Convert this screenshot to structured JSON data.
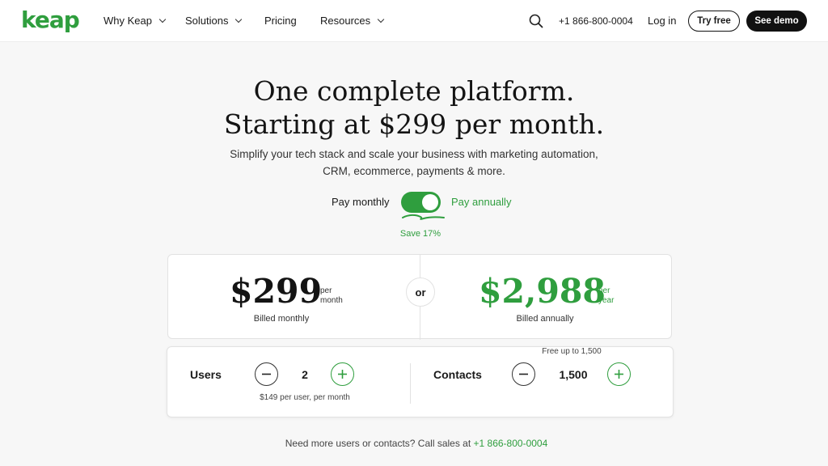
{
  "brand": {
    "logo_text": "keap",
    "accent_color": "#2f9e3e"
  },
  "nav": {
    "items": [
      {
        "label": "Why Keap",
        "has_dropdown": true
      },
      {
        "label": "Solutions",
        "has_dropdown": true
      },
      {
        "label": "Pricing",
        "has_dropdown": false
      },
      {
        "label": "Resources",
        "has_dropdown": true
      }
    ],
    "search_icon": "search-icon",
    "phone": "+1 866-800-0004",
    "login_label": "Log in",
    "try_free_label": "Try free",
    "see_demo_label": "See demo"
  },
  "hero": {
    "title_line1": "One complete platform.",
    "title_line2": "Starting at $299 per month.",
    "subtitle_line1": "Simplify your tech stack and scale your business with marketing automation,",
    "subtitle_line2": "CRM, ecommerce, payments & more."
  },
  "billing_toggle": {
    "monthly_label": "Pay monthly",
    "annual_label": "Pay annually",
    "selected": "annually",
    "save_label": "Save 17%"
  },
  "pricing": {
    "monthly": {
      "amount": "$299",
      "per_line1": "per",
      "per_line2": "month",
      "billed": "Billed monthly"
    },
    "or_label": "or",
    "annual": {
      "amount": "$2,988",
      "per_line1": "per",
      "per_line2": "year",
      "billed": "Billed annually"
    }
  },
  "quantities": {
    "users": {
      "label": "Users",
      "value": "2",
      "note": "$149 per user, per month"
    },
    "contacts": {
      "label": "Contacts",
      "value": "1,500",
      "note": "Free up to 1,500"
    }
  },
  "footer": {
    "text": "Need more users or contacts? Call sales at",
    "phone": "+1 866-800-0004"
  }
}
